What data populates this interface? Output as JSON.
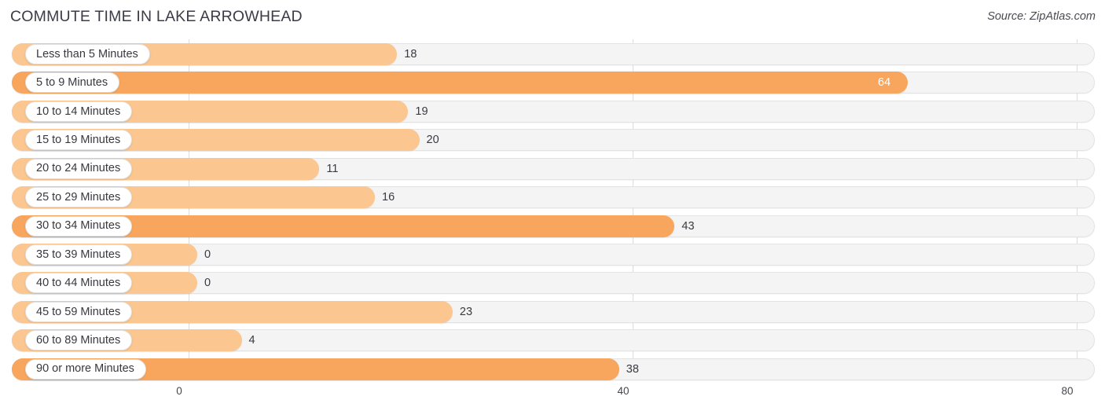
{
  "header": {
    "title": "COMMUTE TIME IN LAKE ARROWHEAD",
    "source": "Source: ZipAtlas.com"
  },
  "colors": {
    "bar_light": "#FBC68F",
    "bar_dark": "#F8A65D",
    "track": "#F4F4F4",
    "grid": "#DCDCDC",
    "text": "#3A3A42",
    "value_inside": "#FFFFFF"
  },
  "chart_data": {
    "type": "bar",
    "orientation": "horizontal",
    "title": "COMMUTE TIME IN LAKE ARROWHEAD",
    "xlabel": "",
    "ylabel": "",
    "xlim": [
      0,
      80
    ],
    "xticks": [
      0,
      40,
      80
    ],
    "xtick_labels": [
      "0",
      "40",
      "80"
    ],
    "grid": true,
    "legend": false,
    "categories": [
      "Less than 5 Minutes",
      "5 to 9 Minutes",
      "10 to 14 Minutes",
      "15 to 19 Minutes",
      "20 to 24 Minutes",
      "25 to 29 Minutes",
      "30 to 34 Minutes",
      "35 to 39 Minutes",
      "40 to 44 Minutes",
      "45 to 59 Minutes",
      "60 to 89 Minutes",
      "90 or more Minutes"
    ],
    "values": [
      18,
      64,
      19,
      20,
      11,
      16,
      43,
      0,
      0,
      23,
      4,
      38
    ],
    "value_labels": [
      "18",
      "64",
      "19",
      "20",
      "11",
      "16",
      "43",
      "0",
      "0",
      "23",
      "4",
      "38"
    ]
  },
  "bars": [
    {
      "label": "Less than 5 Minutes",
      "value": 18,
      "value_label": "18",
      "shade": "light",
      "label_inside": false
    },
    {
      "label": "5 to 9 Minutes",
      "value": 64,
      "value_label": "64",
      "shade": "dark",
      "label_inside": true
    },
    {
      "label": "10 to 14 Minutes",
      "value": 19,
      "value_label": "19",
      "shade": "light",
      "label_inside": false
    },
    {
      "label": "15 to 19 Minutes",
      "value": 20,
      "value_label": "20",
      "shade": "light",
      "label_inside": false
    },
    {
      "label": "20 to 24 Minutes",
      "value": 11,
      "value_label": "11",
      "shade": "light",
      "label_inside": false
    },
    {
      "label": "25 to 29 Minutes",
      "value": 16,
      "value_label": "16",
      "shade": "light",
      "label_inside": false
    },
    {
      "label": "30 to 34 Minutes",
      "value": 43,
      "value_label": "43",
      "shade": "dark",
      "label_inside": false
    },
    {
      "label": "35 to 39 Minutes",
      "value": 0,
      "value_label": "0",
      "shade": "light",
      "label_inside": false
    },
    {
      "label": "40 to 44 Minutes",
      "value": 0,
      "value_label": "0",
      "shade": "light",
      "label_inside": false
    },
    {
      "label": "45 to 59 Minutes",
      "value": 23,
      "value_label": "23",
      "shade": "light",
      "label_inside": false
    },
    {
      "label": "60 to 89 Minutes",
      "value": 4,
      "value_label": "4",
      "shade": "light",
      "label_inside": false
    },
    {
      "label": "90 or more Minutes",
      "value": 38,
      "value_label": "38",
      "shade": "dark",
      "label_inside": false
    }
  ],
  "axis": {
    "ticks": [
      {
        "label": "0",
        "value": 0
      },
      {
        "label": "40",
        "value": 40
      },
      {
        "label": "80",
        "value": 80
      }
    ]
  }
}
